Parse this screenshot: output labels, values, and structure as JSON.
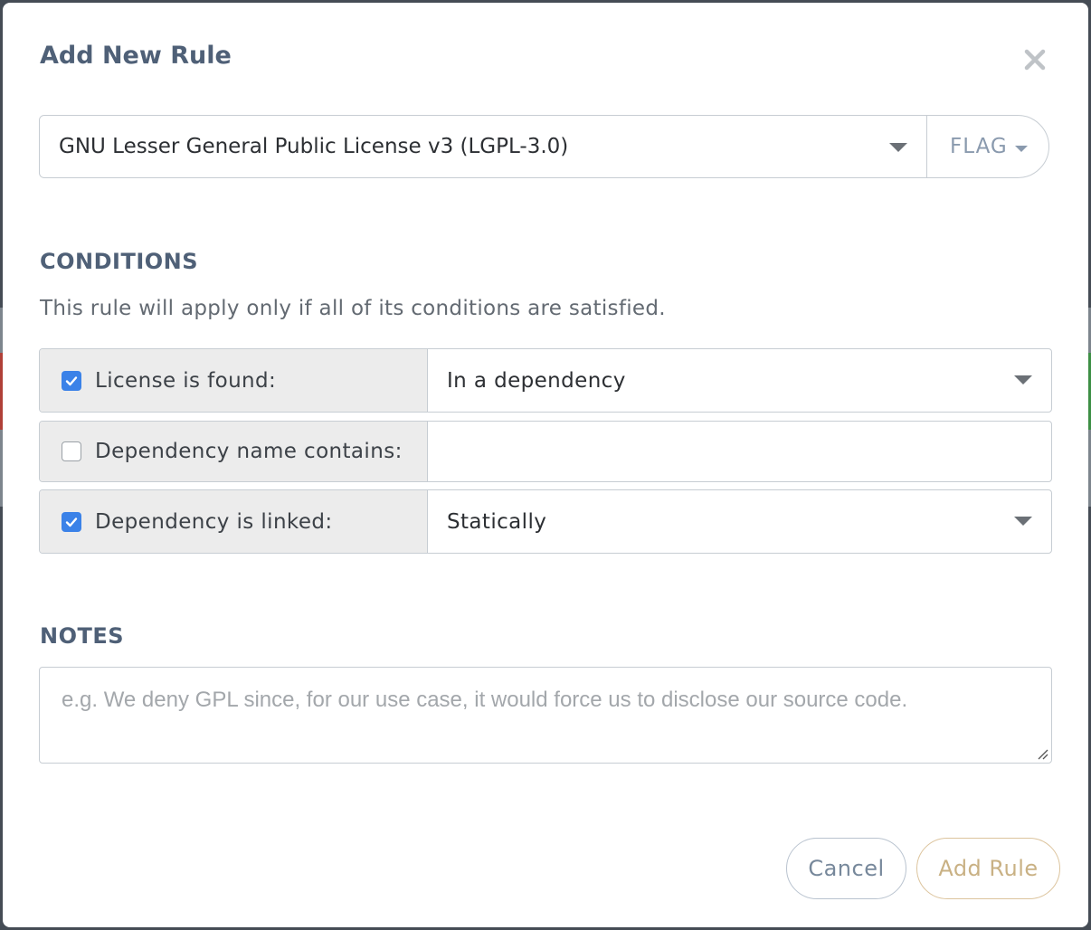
{
  "modal": {
    "title": "Add New Rule",
    "close_icon": "close-icon"
  },
  "license": {
    "selected": "GNU Lesser General Public License v3 (LGPL-3.0)",
    "action": "FLAG"
  },
  "conditions": {
    "heading": "CONDITIONS",
    "help_text": "This rule will apply only if all of its conditions are satisfied.",
    "rows": [
      {
        "label": "License is found:",
        "checked": true,
        "value": "In a dependency",
        "type": "select"
      },
      {
        "label": "Dependency name contains:",
        "checked": false,
        "value": "",
        "type": "text"
      },
      {
        "label": "Dependency is linked:",
        "checked": true,
        "value": "Statically",
        "type": "select"
      }
    ]
  },
  "notes": {
    "heading": "NOTES",
    "value": "",
    "placeholder": "e.g. We deny GPL since, for our use case, it would force us to disclose our source code."
  },
  "buttons": {
    "cancel": "Cancel",
    "add_rule": "Add Rule"
  },
  "colors": {
    "heading": "#4f6077",
    "checkbox_checked": "#3b82e8",
    "add_rule_border": "#dcc49d",
    "cancel_border": "#b9c3cf"
  }
}
